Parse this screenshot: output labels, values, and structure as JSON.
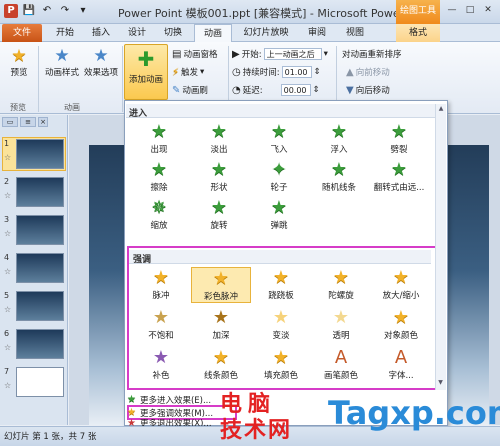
{
  "window": {
    "title": "Power Point  模板001.ppt [兼容模式] - Microsoft Power...",
    "context_tab": "绘图工具",
    "controls": [
      "—",
      "□",
      "✕"
    ]
  },
  "tabs": [
    "文件",
    "开始",
    "插入",
    "设计",
    "切换",
    "动画",
    "幻灯片放映",
    "审阅",
    "视图",
    "格式"
  ],
  "ribbon": {
    "preview": "预览",
    "preview_group": "预览",
    "anim_style": "动画样式",
    "effect_options": "效果选项",
    "anim_group": "动画",
    "add_anim": "添加动画",
    "anim_pane": "动画窗格",
    "trigger": "触发",
    "anim_painter": "动画刷",
    "start_label": "开始:",
    "start_value": "上一动画之后",
    "duration_label": "持续时间:",
    "duration_value": "01.00",
    "delay_label": "延迟:",
    "delay_value": "00.00",
    "reorder_title": "对动画重新排序",
    "move_earlier": "向前移动",
    "move_later": "向后移动"
  },
  "slides": [
    {
      "num": "1",
      "mark": "☆"
    },
    {
      "num": "2",
      "mark": "☆"
    },
    {
      "num": "3",
      "mark": "☆"
    },
    {
      "num": "4",
      "mark": "☆"
    },
    {
      "num": "5",
      "mark": "☆"
    },
    {
      "num": "6",
      "mark": "☆"
    },
    {
      "num": "7",
      "mark": "☆"
    }
  ],
  "gallery": {
    "entrance_header": "进入",
    "entrance": [
      "出现",
      "淡出",
      "飞入",
      "浮入",
      "劈裂",
      "擦除",
      "形状",
      "轮子",
      "随机线条",
      "翻转式由远...",
      "缩放",
      "旋转",
      "弹跳"
    ],
    "emphasis_header": "强调",
    "emphasis": [
      "脉冲",
      "彩色脉冲",
      "跷跷板",
      "陀螺旋",
      "放大/缩小",
      "不饱和",
      "加深",
      "变淡",
      "透明",
      "对象颜色",
      "补色",
      "线条颜色",
      "填充颜色",
      "画笔颜色",
      "字体..."
    ],
    "more_entrance": "更多进入效果(E)...",
    "more_emphasis": "更多强调效果(M)...",
    "more_exit": "更多退出效果(X)..."
  },
  "status": {
    "text": "幻灯片 第 1 张，共 7 张"
  },
  "watermark": {
    "cn_line1": "电脑",
    "cn_line2": "技术网",
    "en": "Tagxp.com"
  }
}
